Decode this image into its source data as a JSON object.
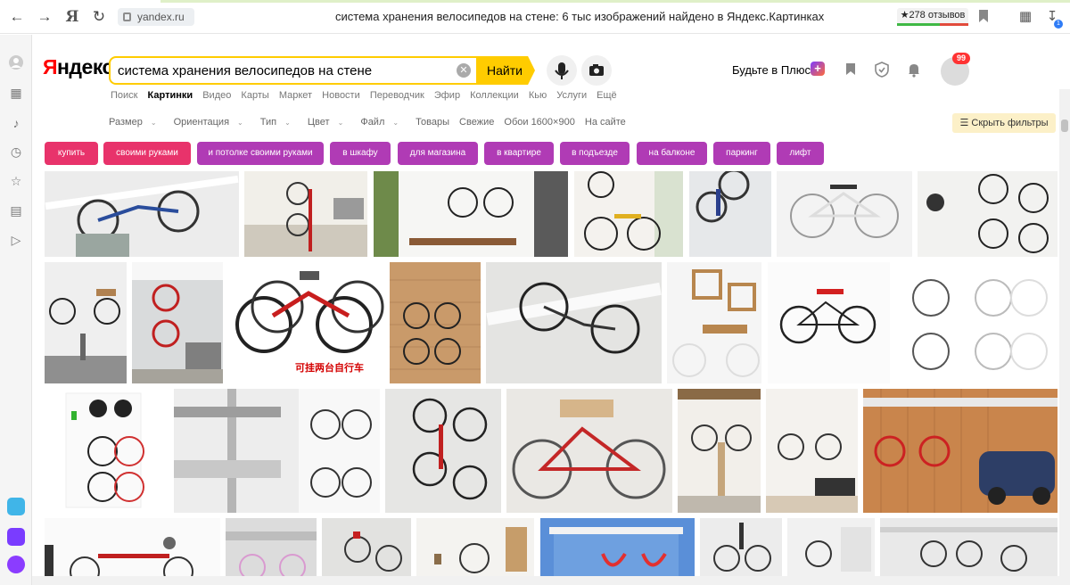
{
  "browser": {
    "url": "yandex.ru",
    "page_title": "система хранения велосипедов на стене: 6 тыс изображений найдено в Яндекс.Картинках",
    "reviews": "★278 отзывов",
    "logo_letter": "Я",
    "download_badge": "1"
  },
  "header": {
    "logo": "Яндекс",
    "search_value": "система хранения велосипедов на стене",
    "find_label": "Найти",
    "plus_text": "Будьте в Плюсе",
    "plus_badge": "+",
    "notifications_count": "99"
  },
  "services": [
    "Поиск",
    "Картинки",
    "Видео",
    "Карты",
    "Маркет",
    "Новости",
    "Переводчик",
    "Эфир",
    "Коллекции",
    "Кью",
    "Услуги",
    "Ещё"
  ],
  "active_service": "Картинки",
  "filters": {
    "size": "Размер",
    "orientation": "Ориентация",
    "type": "Тип",
    "color": "Цвет",
    "file": "Файл",
    "goods": "Товары",
    "fresh": "Свежие",
    "wallpaper": "Обои 1600×900",
    "on_site": "На сайте",
    "hide": "Скрыть фильтры"
  },
  "chips": [
    {
      "label": "купить",
      "color": "#e8336b"
    },
    {
      "label": "своими руками",
      "color": "#e8336b"
    },
    {
      "label": "и потолке своими руками",
      "color": "#b03bb5"
    },
    {
      "label": "в шкафу",
      "color": "#b03bb5"
    },
    {
      "label": "для магазина",
      "color": "#b03bb5"
    },
    {
      "label": "в квартире",
      "color": "#b03bb5"
    },
    {
      "label": "в подъезде",
      "color": "#b03bb5"
    },
    {
      "label": "на балконе",
      "color": "#b03bb5"
    },
    {
      "label": "паркинг",
      "color": "#b03bb5"
    },
    {
      "label": "лифт",
      "color": "#b03bb5"
    }
  ],
  "image_caption_cn": "可挂两台自行车",
  "colors": {
    "search_yellow": "#ffcc00",
    "chip_pink": "#e8336b",
    "chip_purple": "#b03bb5"
  }
}
